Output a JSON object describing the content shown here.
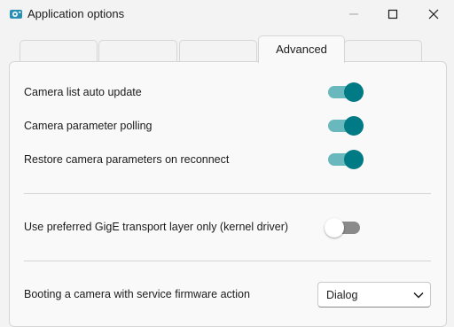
{
  "window": {
    "title": "Application options",
    "icon": "gear-camera-icon"
  },
  "tabs": [
    {
      "label": ""
    },
    {
      "label": ""
    },
    {
      "label": ""
    },
    {
      "label": "Advanced",
      "active": true
    },
    {
      "label": ""
    }
  ],
  "options": {
    "auto_update": {
      "label": "Camera list auto update",
      "enabled": true
    },
    "polling": {
      "label": "Camera parameter polling",
      "enabled": true
    },
    "restore": {
      "label": "Restore camera parameters on reconnect",
      "enabled": true
    },
    "gige": {
      "label": "Use preferred GigE transport layer only (kernel driver)",
      "enabled": false
    }
  },
  "booting": {
    "label": "Booting a camera with service firmware action",
    "selected": "Dialog"
  },
  "colors": {
    "accent": "#007a85",
    "accent_track": "#68b8bd"
  }
}
